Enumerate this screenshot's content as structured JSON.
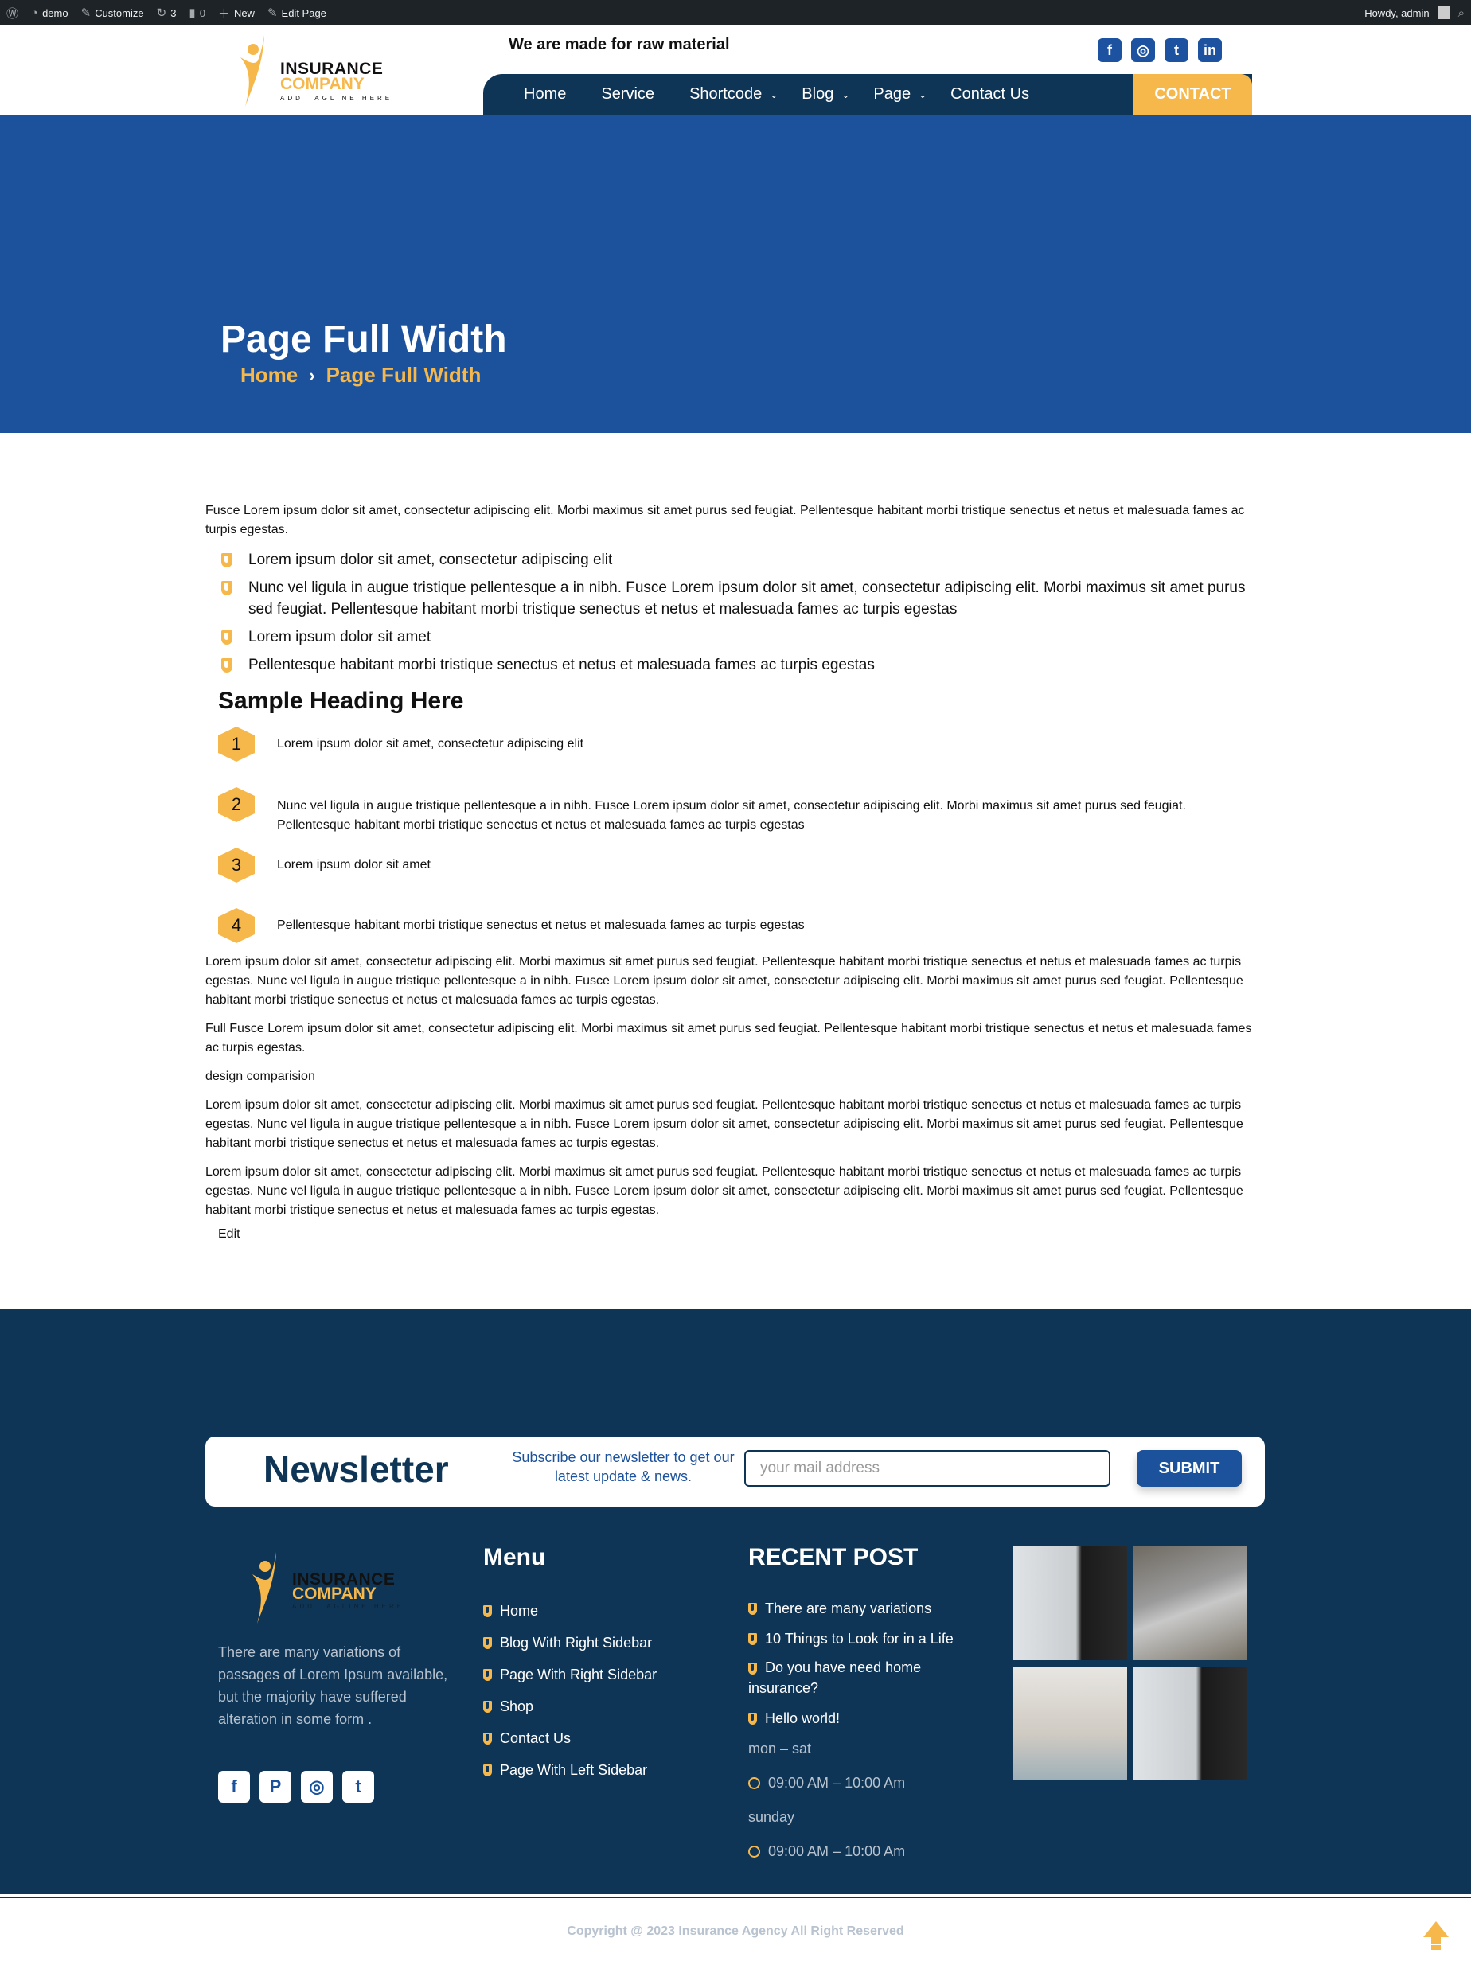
{
  "admin_bar": {
    "site": "demo",
    "customize": "Customize",
    "updates": "3",
    "comments": "0",
    "new": "New",
    "edit_page": "Edit Page",
    "howdy": "Howdy, admin"
  },
  "header": {
    "logo": {
      "line1": "INSURANCE",
      "line2": "COMPANY",
      "tagline": "ADD TAGLINE HERE"
    },
    "tagline": "We are made for raw material",
    "social": [
      "facebook-icon",
      "instagram-icon",
      "twitter-icon",
      "linkedin-icon"
    ],
    "nav": [
      {
        "label": "Home",
        "dropdown": false
      },
      {
        "label": "Service",
        "dropdown": false
      },
      {
        "label": "Shortcode",
        "dropdown": true
      },
      {
        "label": "Blog",
        "dropdown": true
      },
      {
        "label": "Page",
        "dropdown": true
      },
      {
        "label": "Contact Us",
        "dropdown": false
      }
    ],
    "contact_button": "CONTACT"
  },
  "hero": {
    "title": "Page Full Width",
    "breadcrumb": [
      "Home",
      "Page Full Width"
    ]
  },
  "content": {
    "intro": "Fusce Lorem ipsum dolor sit amet, consectetur adipiscing elit. Morbi maximus sit amet purus sed feugiat. Pellentesque habitant morbi tristique senectus et netus et malesuada fames ac turpis egestas.",
    "bullets": [
      "Lorem ipsum dolor sit amet, consectetur adipiscing elit",
      "Nunc vel ligula in augue tristique pellentesque a in nibh. Fusce Lorem ipsum dolor sit amet, consectetur adipiscing elit. Morbi maximus sit amet purus sed feugiat. Pellentesque habitant morbi tristique senectus et netus et malesuada fames ac turpis egestas",
      "Lorem ipsum dolor sit amet",
      "Pellentesque habitant morbi tristique senectus et netus et malesuada fames ac turpis egestas"
    ],
    "heading": "Sample Heading Here",
    "numbered": [
      {
        "num": "1",
        "text": "Lorem ipsum dolor sit amet, consectetur adipiscing elit"
      },
      {
        "num": "2",
        "text": "Nunc vel ligula in augue tristique pellentesque a in nibh. Fusce Lorem ipsum dolor sit amet, consectetur adipiscing elit. Morbi maximus sit amet purus sed feugiat. Pellentesque habitant morbi tristique senectus et netus et malesuada fames ac turpis egestas"
      },
      {
        "num": "3",
        "text": "Lorem ipsum dolor sit amet"
      },
      {
        "num": "4",
        "text": "Pellentesque habitant morbi tristique senectus et netus et malesuada fames ac turpis egestas"
      }
    ],
    "paragraphs": [
      "Lorem ipsum dolor sit amet, consectetur adipiscing elit. Morbi maximus sit amet purus sed feugiat. Pellentesque habitant morbi tristique senectus et netus et malesuada fames ac turpis egestas. Nunc vel ligula in augue tristique pellentesque a in nibh. Fusce Lorem ipsum dolor sit amet, consectetur adipiscing elit. Morbi maximus sit amet purus sed feugiat. Pellentesque habitant morbi tristique senectus et netus et malesuada fames ac turpis egestas.",
      "Full Fusce Lorem ipsum dolor sit amet, consectetur adipiscing elit. Morbi maximus sit amet purus sed feugiat. Pellentesque habitant morbi tristique senectus et netus et malesuada fames ac turpis egestas.",
      "design comparision",
      "Lorem ipsum dolor sit amet, consectetur adipiscing elit. Morbi maximus sit amet purus sed feugiat. Pellentesque habitant morbi tristique senectus et netus et malesuada fames ac turpis egestas. Nunc vel ligula in augue tristique pellentesque a in nibh. Fusce Lorem ipsum dolor sit amet, consectetur adipiscing elit. Morbi maximus sit amet purus sed feugiat. Pellentesque habitant morbi tristique senectus et netus et malesuada fames ac turpis egestas.",
      "Lorem ipsum dolor sit amet, consectetur adipiscing elit. Morbi maximus sit amet purus sed feugiat. Pellentesque habitant morbi tristique senectus et netus et malesuada fames ac turpis egestas. Nunc vel ligula in augue tristique pellentesque a in nibh. Fusce Lorem ipsum dolor sit amet, consectetur adipiscing elit. Morbi maximus sit amet purus sed feugiat. Pellentesque habitant morbi tristique senectus et netus et malesuada fames ac turpis egestas."
    ],
    "edit_link": "Edit"
  },
  "newsletter": {
    "title": "Newsletter",
    "subtitle": "Subscribe our newsletter to get our latest update & news.",
    "placeholder": "your mail address",
    "submit": "SUBMIT"
  },
  "footer": {
    "description": "There are many variations of passages of Lorem Ipsum available, but the majority have suffered alteration in some form .",
    "social": [
      "facebook-icon",
      "pinterest-icon",
      "instagram-icon",
      "twitter-icon"
    ],
    "menu_title": "Menu",
    "menu": [
      "Home",
      "Blog With Right Sidebar",
      "Page With Right Sidebar",
      "Shop",
      "Contact Us",
      "Page With Left Sidebar"
    ],
    "recent_title": "RECENT POST",
    "recent": [
      "There are many variations",
      "10 Things to Look for in a Life",
      "Do you have need home insurance?",
      "Hello world!"
    ],
    "hours": [
      {
        "days": "mon – sat",
        "time": "09:00 AM – 10:00 Am"
      },
      {
        "days": "sunday",
        "time": "09:00 AM – 10:00 Am"
      }
    ],
    "copyright": "Copyright @ 2023 Insurance Agency All Right Reserved"
  },
  "colors": {
    "navy": "#0f3556",
    "blue": "#1c529c",
    "accent": "#f7b84b"
  }
}
